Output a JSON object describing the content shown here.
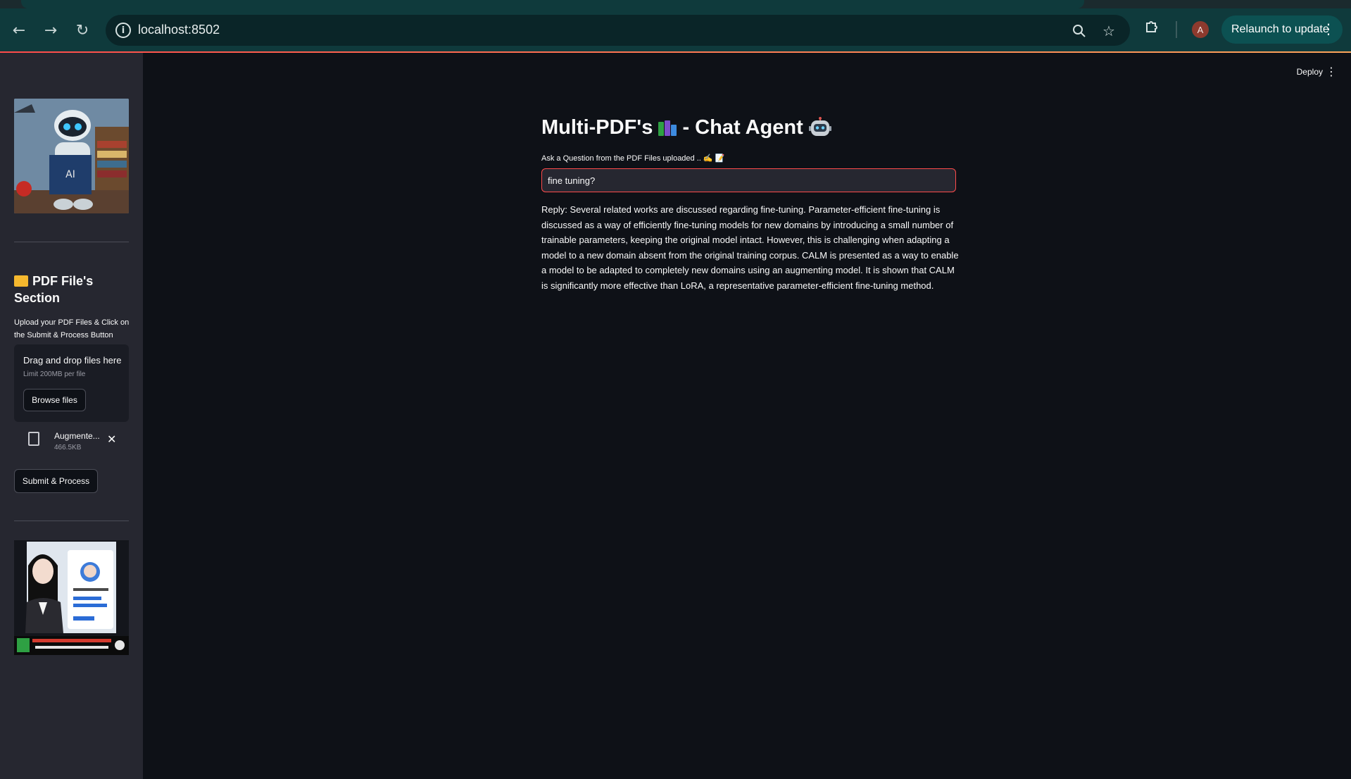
{
  "browser": {
    "url": "localhost:8502",
    "relaunch_label": "Relaunch to update",
    "avatar_letter": "A",
    "menu_glyph": "⋮"
  },
  "header": {
    "deploy_label": "Deploy",
    "menu_glyph": "⋮"
  },
  "sidebar": {
    "section_title": "PDF File's Section",
    "upload_hint": "Upload your PDF Files & Click on the Submit & Process Button",
    "dropzone": {
      "title": "Drag and drop files here",
      "limit": "Limit 200MB per file",
      "browse_label": "Browse files"
    },
    "file": {
      "name": "Augmente...",
      "size": "466.5KB",
      "remove_glyph": "✕"
    },
    "submit_label": "Submit & Process"
  },
  "main": {
    "title_part1": "Multi-PDF's",
    "title_part2": " - Chat Agent ",
    "question_label": "Ask a Question from the PDF Files uploaded .. ✍️ 📝",
    "question_value": "fine tuning?",
    "reply": "Reply: Several related works are discussed regarding fine-tuning. Parameter-efficient fine-tuning is discussed as a way of efficiently fine-tuning models for new domains by introducing a small number of trainable parameters, keeping the original model intact. However, this is challenging when adapting a model to a new domain absent from the original training corpus. CALM is presented as a way to enable a model to be adapted to completely new domains using an augmenting model. It is shown that CALM is significantly more effective than LoRA, a representative parameter-efficient fine-tuning method."
  },
  "icons": {
    "back": "arrow-left-icon",
    "forward": "arrow-right-icon",
    "reload": "reload-icon",
    "info": "info-icon",
    "zoom": "zoom-icon",
    "bookmark": "star-icon",
    "extensions": "puzzle-icon",
    "folder": "folder-icon",
    "file": "file-icon",
    "books": "books-icon",
    "robot": "robot-icon"
  },
  "colors": {
    "accent": "#ff4b4b",
    "sidebar_bg": "#262730",
    "main_bg": "#0e1117",
    "chrome_bg": "#0f3a3c"
  }
}
